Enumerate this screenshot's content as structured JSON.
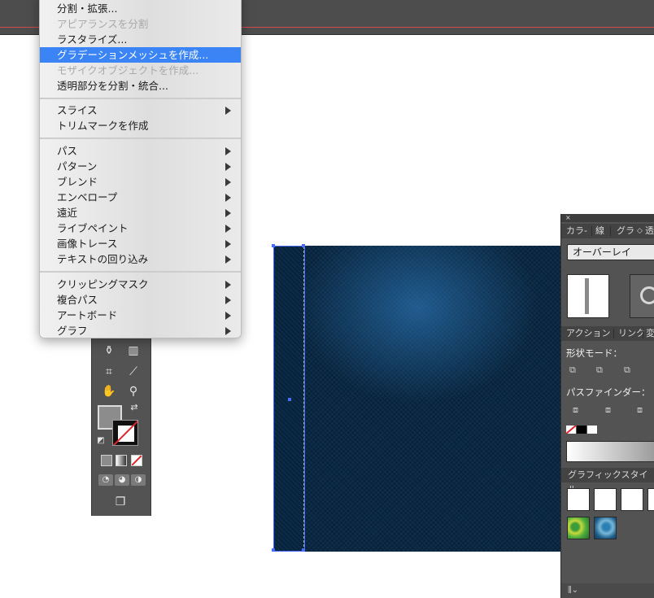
{
  "menu": {
    "items": [
      {
        "label": "分割・拡張...",
        "state": "normal",
        "submenu": false
      },
      {
        "label": "アピアランスを分割",
        "state": "disabled",
        "submenu": false
      },
      {
        "label": "ラスタライズ...",
        "state": "normal",
        "submenu": false
      },
      {
        "label": "グラデーションメッシュを作成...",
        "state": "highlighted",
        "submenu": false
      },
      {
        "label": "モザイクオブジェクトを作成...",
        "state": "disabled",
        "submenu": false
      },
      {
        "label": "透明部分を分割・統合...",
        "state": "normal",
        "submenu": false
      },
      {
        "label": "スライス",
        "state": "normal",
        "submenu": true
      },
      {
        "label": "トリムマークを作成",
        "state": "normal",
        "submenu": false
      },
      {
        "label": "パス",
        "state": "normal",
        "submenu": true
      },
      {
        "label": "パターン",
        "state": "normal",
        "submenu": true
      },
      {
        "label": "ブレンド",
        "state": "normal",
        "submenu": true
      },
      {
        "label": "エンベロープ",
        "state": "normal",
        "submenu": true
      },
      {
        "label": "遠近",
        "state": "normal",
        "submenu": true
      },
      {
        "label": "ライブペイント",
        "state": "normal",
        "submenu": true
      },
      {
        "label": "画像トレース",
        "state": "normal",
        "submenu": true
      },
      {
        "label": "テキストの回り込み",
        "state": "normal",
        "submenu": true
      },
      {
        "label": "クリッピングマスク",
        "state": "normal",
        "submenu": true
      },
      {
        "label": "複合パス",
        "state": "normal",
        "submenu": true
      },
      {
        "label": "アートボード",
        "state": "normal",
        "submenu": true
      },
      {
        "label": "グラフ",
        "state": "normal",
        "submenu": true
      }
    ]
  },
  "panel": {
    "top_tabs": [
      "カラ-",
      "線",
      "グラ",
      "透"
    ],
    "blend_mode": "オーバーレイ",
    "mid_tabs": [
      "アクション",
      "リンク",
      "変"
    ],
    "shape_modes_label": "形状モード：",
    "pathfinder_label": "パスファインダー：",
    "graphic_styles_tab": "グラフィックスタイル"
  },
  "colors": {
    "highlight": "#3b84f5",
    "ui_dark": "#535353",
    "artwork_blue": "#0d2d4a",
    "selection": "#4a6cff"
  },
  "icons": {
    "toolbox": [
      "symbol-sprayer-icon",
      "column-graph-icon",
      "artboard-icon",
      "eyedropper-icon",
      "hand-icon",
      "zoom-icon",
      "swap-fill-stroke-icon",
      "default-fill-stroke-icon"
    ],
    "pathfinder": [
      "unite-icon",
      "minus-front-icon",
      "intersect-icon",
      "exclude-icon"
    ]
  }
}
